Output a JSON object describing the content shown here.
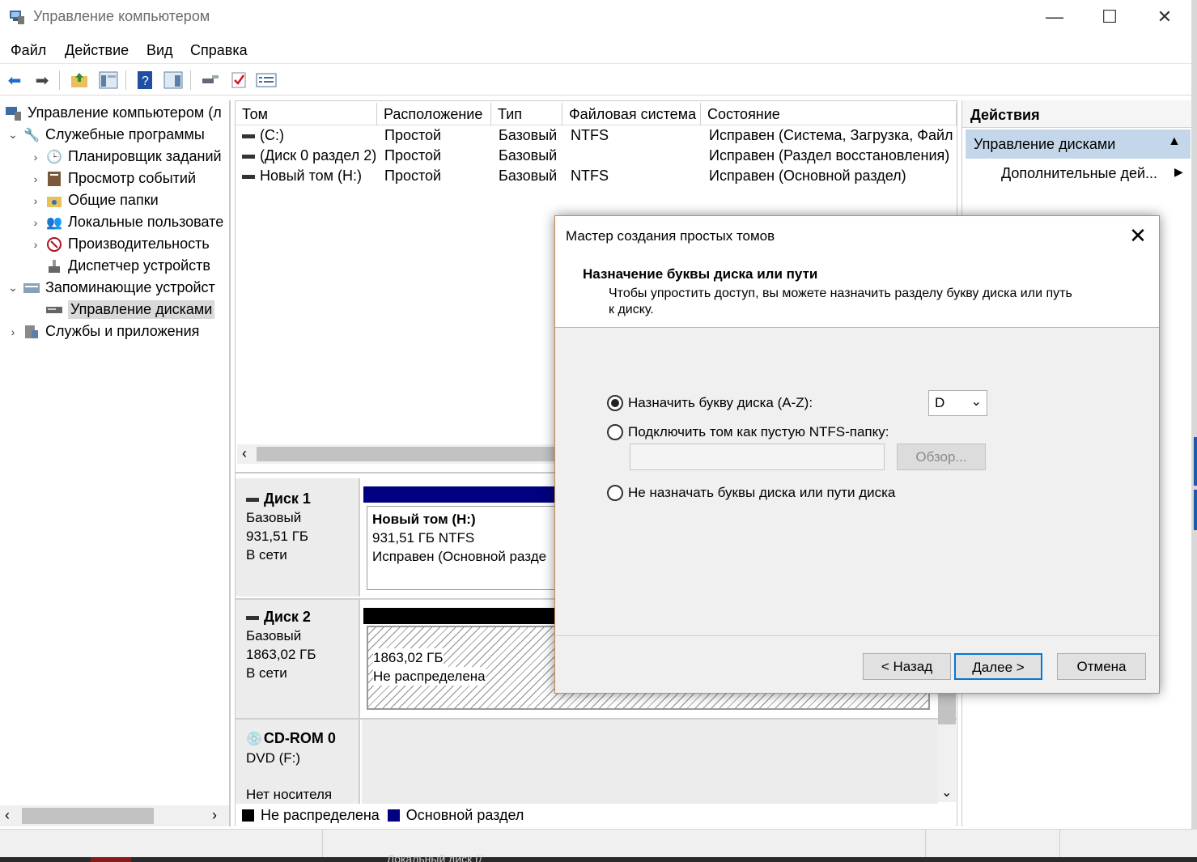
{
  "window": {
    "title": "Управление компьютером",
    "minimize": "—",
    "maximize": "☐",
    "close": "✕"
  },
  "menu": [
    "Файл",
    "Действие",
    "Вид",
    "Справка"
  ],
  "toolbar": {
    "icons": [
      "back-arrow-icon",
      "forward-arrow-icon",
      "up-folder-icon",
      "show-tree-icon",
      "help-icon",
      "properties-icon",
      "connect-icon",
      "check-icon",
      "list-icon"
    ]
  },
  "tree": {
    "root": "Управление компьютером (л",
    "items": [
      {
        "label": "Служебные программы",
        "icon": "tools-icon"
      },
      {
        "label": "Планировщик заданий",
        "icon": "clock-icon"
      },
      {
        "label": "Просмотр событий",
        "icon": "event-viewer-icon"
      },
      {
        "label": "Общие папки",
        "icon": "shared-folder-icon"
      },
      {
        "label": "Локальные пользовате",
        "icon": "users-icon"
      },
      {
        "label": "Производительность",
        "icon": "performance-icon"
      },
      {
        "label": "Диспетчер устройств",
        "icon": "device-manager-icon"
      },
      {
        "label": "Запоминающие устройст",
        "icon": "storage-icon"
      },
      {
        "label": "Управление дисками",
        "icon": "disk-management-icon"
      },
      {
        "label": "Службы и приложения",
        "icon": "services-icon"
      }
    ]
  },
  "volumes": {
    "columns": [
      "Том",
      "Расположение",
      "Тип",
      "Файловая система",
      "Состояние"
    ],
    "rows": [
      {
        "name": "(C:)",
        "layout": "Простой",
        "type": "Базовый",
        "fs": "NTFS",
        "status": "Исправен (Система, Загрузка, Файл г"
      },
      {
        "name": "(Диск 0 раздел 2)",
        "layout": "Простой",
        "type": "Базовый",
        "fs": "",
        "status": "Исправен (Раздел восстановления)"
      },
      {
        "name": "Новый том (H:)",
        "layout": "Простой",
        "type": "Базовый",
        "fs": "NTFS",
        "status": "Исправен (Основной раздел)"
      }
    ]
  },
  "disks": [
    {
      "name": "Диск 1",
      "type": "Базовый",
      "size": "931,51 ГБ",
      "state": "В сети",
      "part_title": "Новый том  (H:)",
      "part_size": "931,51 ГБ NTFS",
      "part_status": "Исправен (Основной разде"
    },
    {
      "name": "Диск 2",
      "type": "Базовый",
      "size": "1863,02 ГБ",
      "state": "В сети",
      "part_size": "1863,02 ГБ",
      "part_status": "Не распределена"
    },
    {
      "name": "CD-ROM 0",
      "type": "DVD (F:)",
      "state": "Нет носителя"
    }
  ],
  "legend": {
    "unallocated": "Не распределена",
    "primary": "Основной раздел",
    "unallocated_color": "#000000",
    "primary_color": "#000080"
  },
  "actions": {
    "header": "Действия",
    "section": "Управление дисками",
    "more": "Дополнительные дей..."
  },
  "taskbar_text": "Локальный диск (/",
  "dialog": {
    "title": "Мастер создания простых томов",
    "heading": "Назначение буквы диска или пути",
    "description": "Чтобы упростить доступ, вы можете назначить разделу букву диска или путь к диску.",
    "option_assign": "Назначить букву диска (A-Z):",
    "option_mount": "Подключить том как пустую NTFS-папку:",
    "option_none": "Не назначать буквы диска или пути диска",
    "selected_letter": "D",
    "browse": "Обзор...",
    "back": "< Назад",
    "next": "Далее >",
    "cancel": "Отмена"
  }
}
